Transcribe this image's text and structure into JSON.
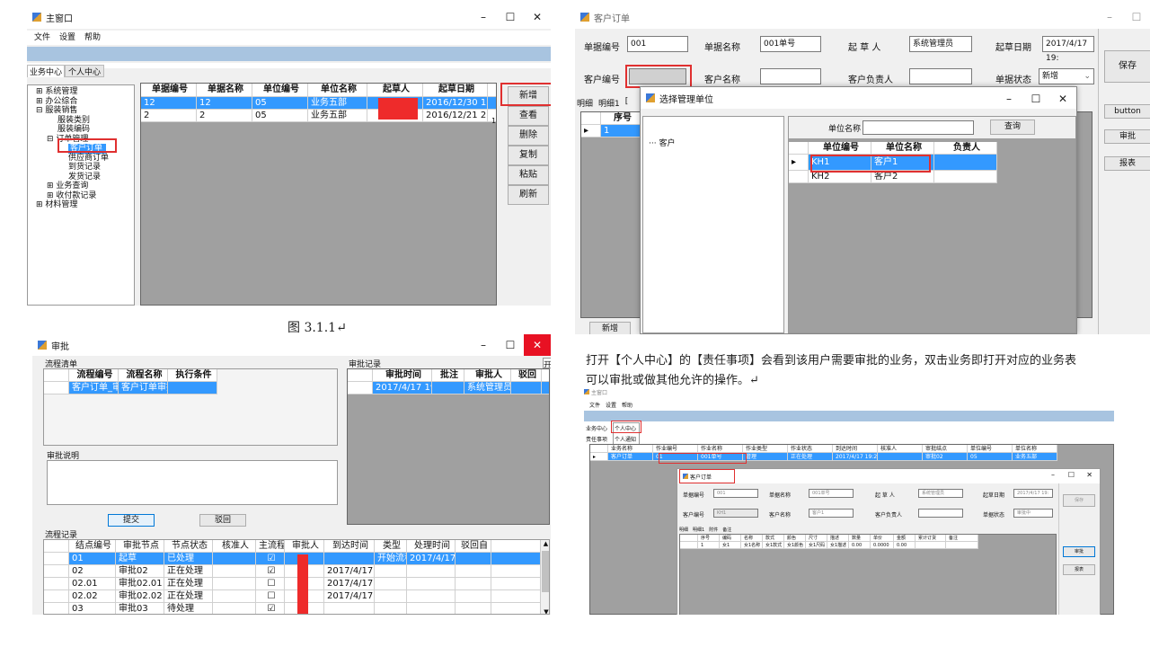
{
  "win1": {
    "title": "主窗口",
    "menu": [
      "文件",
      "设置",
      "帮助"
    ],
    "tabs": [
      "业务中心",
      "个人中心"
    ],
    "tree": [
      "⊞ 系统管理",
      "⊞ 办公综合",
      "⊟ 服装销售",
      "服装类别",
      "服装编码",
      "⊟ 订单管理",
      "客户订单",
      "供应商订单",
      "到货记录",
      "发货记录",
      "⊞ 业务查询",
      "⊞ 收付款记录",
      "⊞ 材料管理"
    ],
    "columns": [
      "单据编号",
      "单据名称",
      "单位编号",
      "单位名称",
      "起草人",
      "起草日期"
    ],
    "rows": [
      [
        "12",
        "12",
        "05",
        "业务五部",
        "",
        "2016/12/30 1..."
      ],
      [
        "2",
        "2",
        "05",
        "业务五部",
        "",
        "2016/12/21 2..."
      ]
    ],
    "row2_extra": "1",
    "buttons": [
      "新增",
      "查看",
      "删除",
      "复制",
      "粘贴",
      "刷新"
    ]
  },
  "caption1": "图 3.1.1↵",
  "win2": {
    "title": "客户订单",
    "labels": [
      "单据编号",
      "单据名称",
      "起 草 人",
      "起草日期",
      "客户编号",
      "客户名称",
      "客户负责人",
      "单据状态"
    ],
    "values": {
      "doc_no": "001",
      "doc_name": "001单号",
      "drafter": "系统管理员",
      "draft_date": "2017/4/17 19:",
      "status": "新增",
      "cust_no": "",
      "cust_name": "",
      "cust_owner": ""
    },
    "tabs": [
      "明细",
      "明细1",
      "["
    ],
    "grid_head": "序号",
    "grid_row": "1",
    "side_buttons": [
      "保存",
      "button",
      "审批",
      "报表"
    ],
    "add_button": "新增"
  },
  "dialog": {
    "title": "选择管理单位",
    "tree_item": "客户",
    "search_label": "单位名称",
    "search_value": "",
    "search_button": "查询",
    "columns": [
      "单位编号",
      "单位名称",
      "负责人"
    ],
    "rows": [
      [
        "KH1",
        "客户1",
        ""
      ],
      [
        "KH2",
        "客户2",
        ""
      ]
    ]
  },
  "win3": {
    "title": "审批",
    "flow_list_title": "流程清单",
    "flow_cols": [
      "流程编号",
      "流程名称",
      "执行条件"
    ],
    "flow_row": [
      "客户订单_审批",
      "客户订单审批",
      ""
    ],
    "record_title": "审批记录",
    "record_cols": [
      "审批时间",
      "批注",
      "审批人",
      "驳回"
    ],
    "record_row": [
      "2017/4/17 19:20",
      "",
      "系统管理员",
      ""
    ],
    "note_title": "审批说明",
    "submit": "提交",
    "reject": "驳回",
    "flow_record_title": "流程记录",
    "fr_cols": [
      "结点编号",
      "审批节点",
      "节点状态",
      "核准人",
      "主流程",
      "审批人",
      "到达时间",
      "类型",
      "处理时间",
      "驳回自"
    ],
    "fr_rows": [
      [
        "01",
        "起草",
        "已处理",
        "",
        "☑",
        "",
        "",
        "开始流程",
        "2017/4/17...",
        ""
      ],
      [
        "02",
        "审批02",
        "正在处理",
        "",
        "☑",
        "",
        "2017/4/17...",
        "",
        "",
        ""
      ],
      [
        "02.01",
        "审批02.01",
        "正在处理",
        "",
        "☐",
        "",
        "2017/4/17...",
        "",
        "",
        ""
      ],
      [
        "02.02",
        "审批02.02",
        "正在处理",
        "",
        "☐",
        "",
        "2017/4/17...",
        "",
        "",
        ""
      ],
      [
        "03",
        "审批03",
        "待处理",
        "",
        "☑",
        "",
        "",
        "",
        "",
        ""
      ]
    ],
    "right_edge": "开"
  },
  "para": {
    "line1": "打开【个人中心】的【责任事项】会看到该用户需要审批的业务，双击业务即打开对应的业务表",
    "line2": "可以审批或做其他允许的操作。↵"
  },
  "win4": {
    "title": "主窗口",
    "menu": [
      "文件",
      "设置",
      "帮助"
    ],
    "tabs": [
      "业务中心",
      "个人中心"
    ],
    "popup": [
      "个人中心",
      "个人通知"
    ],
    "subtab": "责任事项",
    "cols": [
      "业务名称",
      "作业编号",
      "作业名称",
      "作业类型",
      "作业状态",
      "到达时间",
      "核准人",
      "审批结点",
      "单位编号",
      "单位名称"
    ],
    "row": [
      "客户订单",
      "01",
      "001单号",
      "管理",
      "正在处理",
      "2017/4/17 19:20",
      "",
      "审批02",
      "05",
      "业务五部"
    ],
    "inner_title": "客户订单",
    "inner_labels": [
      "单据编号",
      "单据名称",
      "起 草 人",
      "起草日期",
      "客户编号",
      "客户名称",
      "客户负责人",
      "单据状态"
    ],
    "inner_values": [
      "001",
      "001单号",
      "系统管理员",
      "2017/4/17 19:",
      "KH1",
      "客户1",
      "",
      "审批中"
    ],
    "inner_tabs": [
      "明细",
      "明细1",
      "附件",
      "备注"
    ],
    "inner_cols": [
      "序号",
      "编码",
      "名称",
      "款式",
      "颜色",
      "尺寸",
      "描述",
      "数量",
      "单价",
      "金额",
      "累计订货",
      "备注"
    ],
    "inner_row": [
      "1",
      "女1",
      "女1名称",
      "女1款式",
      "女1颜色",
      "女1尺码",
      "女1描述",
      "0.00",
      "0.0000",
      "0.00",
      "",
      ""
    ],
    "inner_buttons": [
      "保存",
      "审批",
      "报表"
    ]
  }
}
